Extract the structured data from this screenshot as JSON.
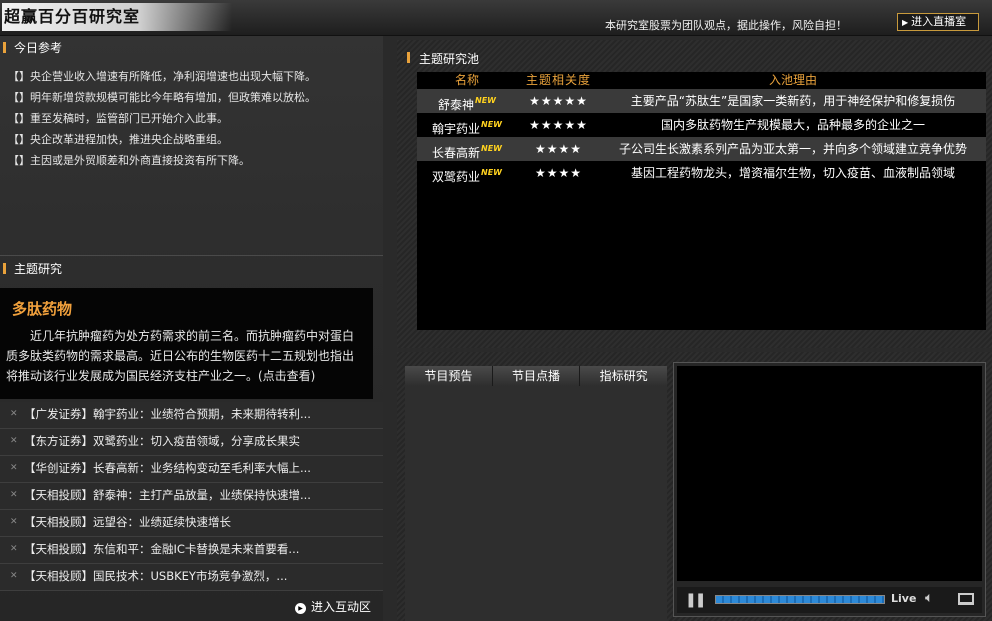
{
  "header": {
    "title": "超赢百分百研究室",
    "disclaimer": "本研究室股票为团队观点，据此操作，风险自担！",
    "live_button": "进入直播室"
  },
  "today": {
    "title": "今日参考",
    "items": [
      "【】央企营业收入增速有所降低，净利润增速也出现大幅下降。",
      "【】明年新增贷款规模可能比今年略有增加，但政策难以放松。",
      "【】重至发稿时，监管部门已开始介入此事。",
      "【】央企改革进程加快，推进央企战略重组。",
      "【】主因或是外贸顺差和外商直接投资有所下降。"
    ]
  },
  "topic": {
    "section_title": "主题研究",
    "name": "多肽药物",
    "desc": "近几年抗肿瘤药为处方药需求的前三名。而抗肿瘤药中对蛋白质多肽类药物的需求最高。近日公布的生物医药十二五规划也指出将推动该行业发展成为国民经济支柱产业之一。(点击查看)"
  },
  "reports": [
    "【广发证券】翰宇药业：业绩符合预期，未来期待转利...",
    "【东方证券】双鹭药业：切入疫苗领域，分享成长果实",
    "【华创证券】长春高新：业务结构变动至毛利率大幅上...",
    "【天相投顾】舒泰神：主打产品放量，业绩保持快速增...",
    "【天相投顾】远望谷：业绩延续快速增长",
    "【天相投顾】东信和平：金融IC卡替换是未来首要看...",
    "【天相投顾】国民技术：USBKEY市场竞争激烈，..."
  ],
  "interact_link": "进入互动区",
  "pool": {
    "title": "主题研究池",
    "headers": [
      "名称",
      "主题相关度",
      "入池理由"
    ],
    "new_badge": "NEW",
    "rows": [
      {
        "name": "舒泰神",
        "stars": "★★★★★",
        "reason": "主要产品“苏肽生”是国家一类新药，用于神经保护和修复损伤"
      },
      {
        "name": "翰宇药业",
        "stars": "★★★★★",
        "reason": "国内多肽药物生产规模最大，品种最多的企业之一"
      },
      {
        "name": "长春高新",
        "stars": "★★★★",
        "reason": "子公司生长激素系列产品为亚太第一，并向多个领域建立竞争优势"
      },
      {
        "name": "双鹭药业",
        "stars": "★★★★",
        "reason": "基因工程药物龙头，增资福尔生物，切入疫苗、血液制品领域"
      }
    ]
  },
  "video": {
    "tabs": [
      "节目预告",
      "节目点播",
      "指标研究"
    ],
    "live_label": "Live",
    "progress": 1.0
  }
}
